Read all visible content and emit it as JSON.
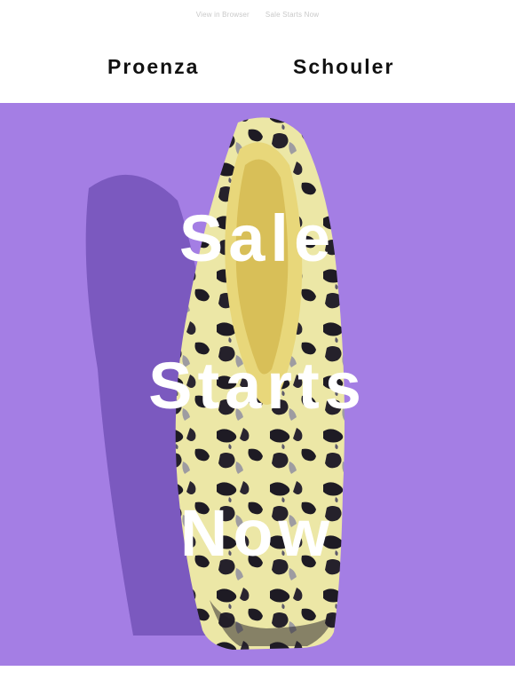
{
  "preheader": {
    "view_in_browser": "View in Browser",
    "sale_link": "Sale Starts Now"
  },
  "brand": {
    "word1": "Proenza",
    "word2": "Schouler"
  },
  "hero": {
    "line1": "Sale",
    "line2": "Starts",
    "line3": "Now",
    "background_color": "#a47ee4",
    "image": "snakeskin-print-shoe-on-lilac-background"
  }
}
